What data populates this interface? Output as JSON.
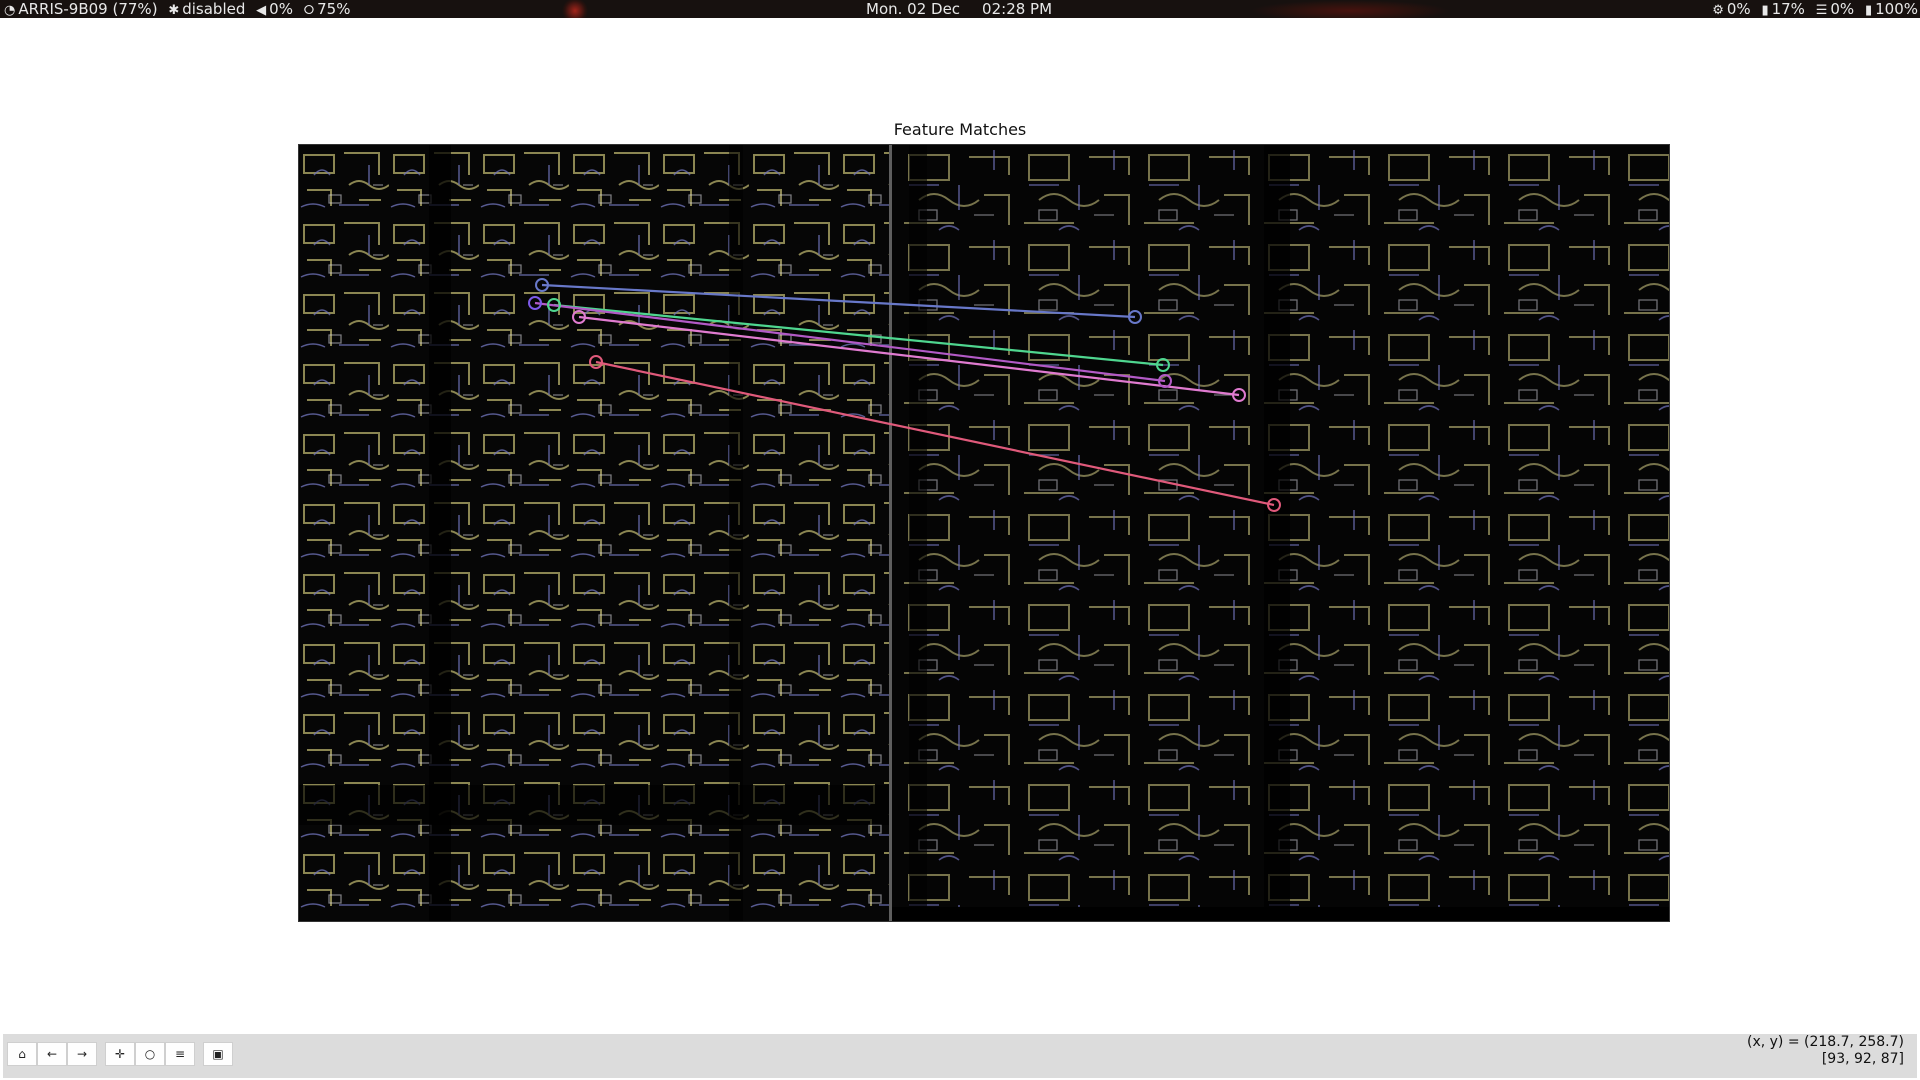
{
  "topbar": {
    "wifi_icon": "wifi-icon",
    "network": "ARRIS-9B09 (77%)",
    "bluetooth_icon": "bluetooth-icon",
    "bluetooth": "disabled",
    "volume_icon": "speaker-icon",
    "volume": "0%",
    "brightness_icon": "lightbulb-icon",
    "brightness": "75%",
    "date": "Mon. 02 Dec",
    "time": "02:28 PM",
    "cpu_icon": "cpu-icon",
    "cpu": "0%",
    "mem_icon": "memory-icon",
    "mem": "17%",
    "disk_icon": "disk-icon",
    "disk": "0%",
    "battery_icon": "battery-icon",
    "battery": "100%"
  },
  "figure": {
    "title": "Feature Matches",
    "colors": {
      "background": "#050505",
      "edges_yellow": "#c9c27a",
      "edges_blue": "#6d6fb5",
      "edges_white": "#d8d8e0"
    },
    "matches": [
      {
        "color": "#6878c9",
        "from": "blue-marker-left",
        "to": "blue-marker-right"
      },
      {
        "color": "#4fd68f",
        "from": "green-marker-left",
        "to": "green-marker-right"
      },
      {
        "color": "#b25ac6",
        "from": "purple-marker-left",
        "to": "purple-marker-right"
      },
      {
        "color": "#e07bd0",
        "from": "pink-marker-left",
        "to": "pink-marker-right"
      },
      {
        "color": "#e05a7b",
        "from": "red-marker-left",
        "to": "red-marker-right"
      }
    ]
  },
  "toolbar": {
    "home_icon": "home-icon",
    "back_icon": "back-arrow-icon",
    "forward_icon": "forward-arrow-icon",
    "pan_icon": "pan-icon",
    "zoom_icon": "zoom-icon",
    "configure_icon": "configure-icon",
    "save_icon": "save-icon"
  },
  "status": {
    "coords": "(x, y) = (218.7, 258.7)",
    "pixel": "[93, 92, 87]"
  }
}
